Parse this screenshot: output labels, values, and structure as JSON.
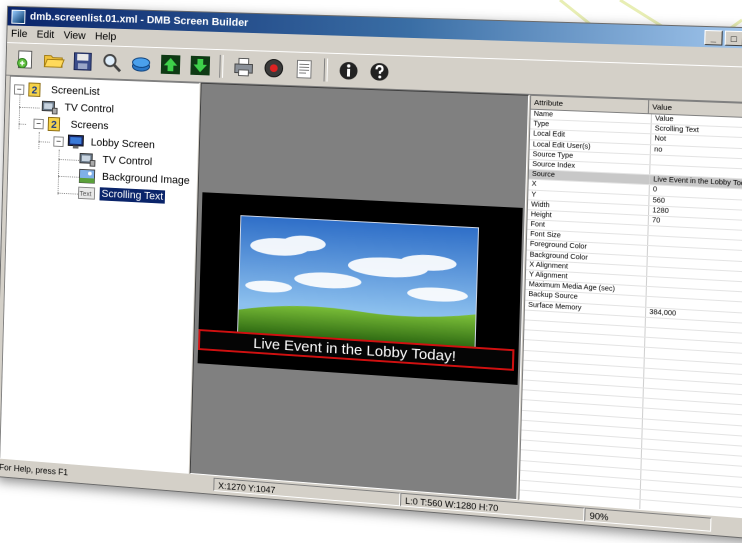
{
  "window": {
    "title": "dmb.screenlist.01.xml - DMB Screen Builder"
  },
  "menu": [
    "File",
    "Edit",
    "View",
    "Help"
  ],
  "toolbar": {
    "buttons": [
      "new-icon",
      "open-folder-icon",
      "save-icon",
      "zoom-icon",
      "publish-icon",
      "move-up-icon",
      "move-down-icon",
      "print-icon",
      "record-icon",
      "notes-icon",
      "info-icon",
      "help-icon"
    ]
  },
  "tree": {
    "root": "ScreenList",
    "tv_control": "TV Control",
    "screens": "Screens",
    "lobby_screen": "Lobby Screen",
    "lobby_tv_control": "TV Control",
    "background_image": "Background Image",
    "scrolling_text": "Scrolling Text",
    "text_icon_label": "Text"
  },
  "canvas": {
    "scroll_text": "Live Event in the Lobby Today!"
  },
  "properties": {
    "headers": [
      "Attribute",
      "Value"
    ],
    "rows": [
      [
        "Name",
        "Value"
      ],
      [
        "Type",
        "Scrolling Text"
      ],
      [
        "Local Edit",
        "Not"
      ],
      [
        "Local Edit User(s)",
        "no"
      ],
      [
        "Source Type",
        ""
      ],
      [
        "Source Index",
        ""
      ],
      [
        "Source",
        "Live Event in the Lobby Today!"
      ],
      [
        "X",
        "0"
      ],
      [
        "Y",
        "560"
      ],
      [
        "Width",
        "1280"
      ],
      [
        "Height",
        "70"
      ],
      [
        "Font",
        ""
      ],
      [
        "Font Size",
        ""
      ],
      [
        "Foreground Color",
        ""
      ],
      [
        "Background Color",
        ""
      ],
      [
        "X Alignment",
        ""
      ],
      [
        "Y Alignment",
        ""
      ],
      [
        "Maximum Media Age (sec)",
        ""
      ],
      [
        "Backup Source",
        ""
      ],
      [
        "Surface Memory",
        "384,000"
      ]
    ]
  },
  "status": {
    "help": "For Help, press F1",
    "cursor": "X:1270  Y:1047",
    "selection": "L:0 T:560 W:1280 H:70",
    "zoom": "90%"
  },
  "colors": {
    "title_start": "#0a246a",
    "selection": "#0a246a",
    "scroll_border": "#d01010",
    "accent_dots": "#e4ec9a"
  }
}
